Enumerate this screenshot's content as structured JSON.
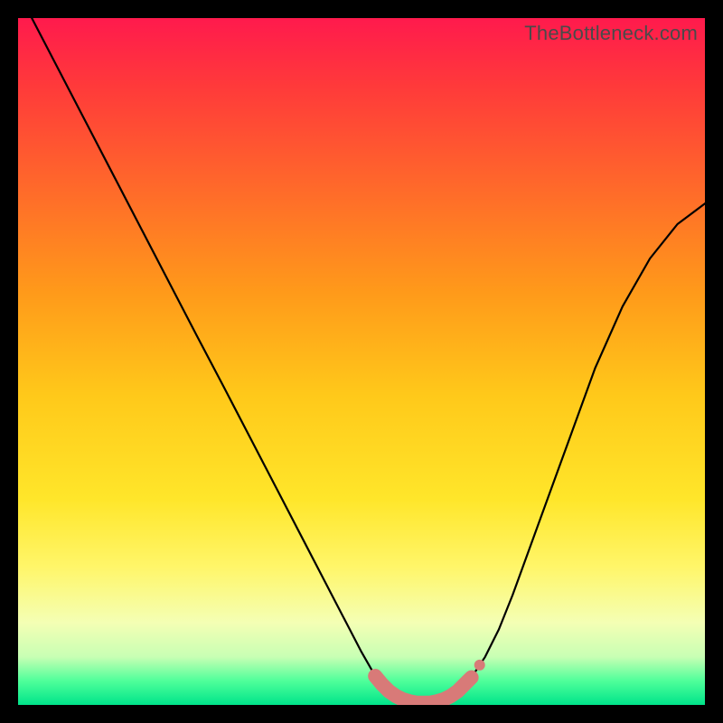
{
  "watermark": "TheBottleneck.com",
  "colors": {
    "frame": "#000000",
    "curve": "#000000",
    "marker_fill": "#d87a78",
    "marker_stroke": "#d87a78",
    "gradient_stops": [
      {
        "offset": 0.0,
        "color": "#ff1a4d"
      },
      {
        "offset": 0.1,
        "color": "#ff3a3a"
      },
      {
        "offset": 0.25,
        "color": "#ff6a2a"
      },
      {
        "offset": 0.4,
        "color": "#ff9a1a"
      },
      {
        "offset": 0.55,
        "color": "#ffc91a"
      },
      {
        "offset": 0.7,
        "color": "#ffe62a"
      },
      {
        "offset": 0.8,
        "color": "#fff66a"
      },
      {
        "offset": 0.88,
        "color": "#f4ffb4"
      },
      {
        "offset": 0.93,
        "color": "#c8ffb4"
      },
      {
        "offset": 0.965,
        "color": "#4fff9a"
      },
      {
        "offset": 1.0,
        "color": "#00e48a"
      }
    ]
  },
  "chart_data": {
    "type": "line",
    "title": "",
    "xlabel": "",
    "ylabel": "",
    "xlim": [
      0,
      100
    ],
    "ylim": [
      0,
      100
    ],
    "series": [
      {
        "name": "curve",
        "x": [
          2,
          6,
          10,
          14,
          18,
          22,
          26,
          30,
          34,
          38,
          42,
          46,
          50,
          52,
          54,
          56,
          58,
          60,
          62,
          64,
          66,
          68,
          70,
          72,
          76,
          80,
          84,
          88,
          92,
          96,
          100
        ],
        "y": [
          100,
          92.3,
          84.6,
          76.9,
          69.2,
          61.5,
          53.8,
          46.2,
          38.5,
          30.8,
          23.1,
          15.4,
          7.7,
          4.2,
          2.0,
          0.8,
          0.3,
          0.3,
          0.8,
          2.0,
          4.0,
          7.0,
          11.0,
          16.0,
          27.0,
          38.0,
          49.0,
          58.0,
          65.0,
          70.0,
          73.0
        ]
      }
    ],
    "markers": {
      "name": "optimal-range",
      "x": [
        52,
        53,
        54,
        55,
        56,
        57,
        58,
        59,
        60,
        61,
        62,
        63,
        64,
        65,
        66
      ],
      "y": [
        4.2,
        3.0,
        2.0,
        1.3,
        0.8,
        0.5,
        0.3,
        0.3,
        0.3,
        0.5,
        0.8,
        1.3,
        2.0,
        3.0,
        4.0
      ]
    },
    "end_dot": {
      "x": 66,
      "y": 4.0
    }
  }
}
